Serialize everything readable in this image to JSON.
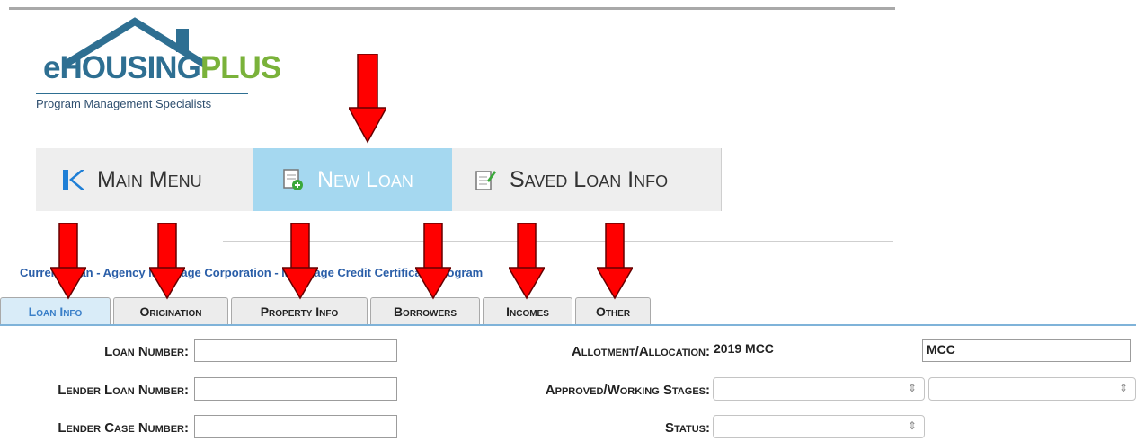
{
  "logo": {
    "brand_main": "eHOUSING",
    "brand_accent": "PLUS",
    "tagline": "Program Management Specialists"
  },
  "nav": {
    "items": [
      {
        "label": "Main Menu",
        "icon": "back-k-icon",
        "active": false
      },
      {
        "label": "New Loan",
        "icon": "new-document-icon",
        "active": true
      },
      {
        "label": "Saved Loan Info",
        "icon": "edit-document-icon",
        "active": false
      }
    ]
  },
  "breadcrumb": "Current Loan - Agency Mortgage Corporation - Mortgage Credit Certificate Program",
  "tabs": [
    {
      "label": "Loan Info",
      "active": true
    },
    {
      "label": "Origination",
      "active": false
    },
    {
      "label": "Property Info",
      "active": false
    },
    {
      "label": "Borrowers",
      "active": false
    },
    {
      "label": "Incomes",
      "active": false
    },
    {
      "label": "Other",
      "active": false
    }
  ],
  "form": {
    "loan_number_label": "Loan Number:",
    "loan_number_value": "",
    "lender_loan_number_label": "Lender Loan Number:",
    "lender_loan_number_value": "",
    "lender_case_number_label": "Lender Case Number:",
    "lender_case_number_value": "",
    "allotment_label": "Allotment/Allocation:",
    "allotment_value": "2019 MCC",
    "allotment_type_value": "MCC",
    "stages_label": "Approved/Working Stages:",
    "stages_value_1": "",
    "stages_value_2": "",
    "status_label": "Status:",
    "status_value": ""
  },
  "colors": {
    "arrow": "#ff0000",
    "active_nav": "#a5d8f0",
    "brand_blue": "#2e6f92",
    "brand_green": "#7ab23a"
  }
}
